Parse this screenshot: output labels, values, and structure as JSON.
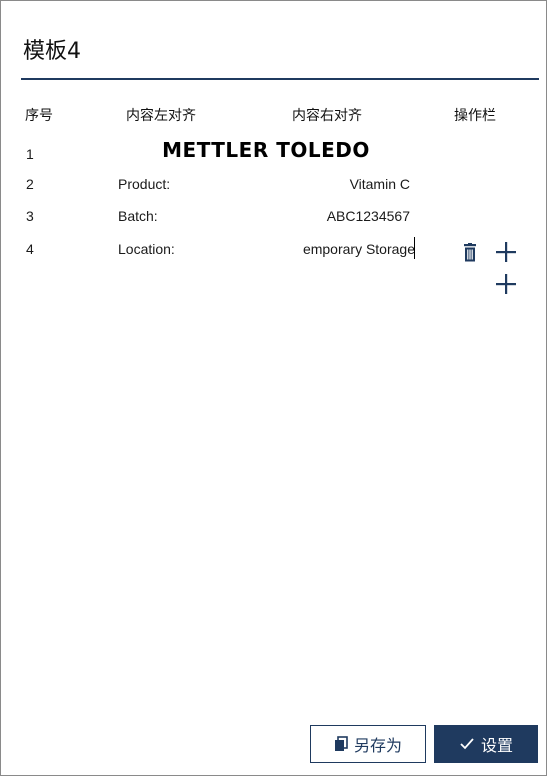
{
  "template": {
    "title": "模板4"
  },
  "table": {
    "headers": {
      "index": "序号",
      "left_align": "内容左对齐",
      "right_align": "内容右对齐",
      "actions": "操作栏"
    },
    "rows": [
      {
        "index": "1",
        "logo_text": "METTLER TOLEDO"
      },
      {
        "index": "2",
        "left": "Product:",
        "right": "Vitamin C"
      },
      {
        "index": "3",
        "left": "Batch:",
        "right": "ABC1234567"
      },
      {
        "index": "4",
        "left": "Location:",
        "right": "emporary Storage"
      }
    ]
  },
  "icons": {
    "delete": "trash-icon",
    "add_field": "plus-icon",
    "add_row": "plus-icon",
    "save_as": "copy-icon",
    "confirm": "check-icon"
  },
  "footer": {
    "save_as_label": "另存为",
    "set_label": "设置"
  },
  "colors": {
    "accent": "#1f3a5f",
    "border": "#8a8a8a",
    "icon": "#1f3a5f"
  }
}
